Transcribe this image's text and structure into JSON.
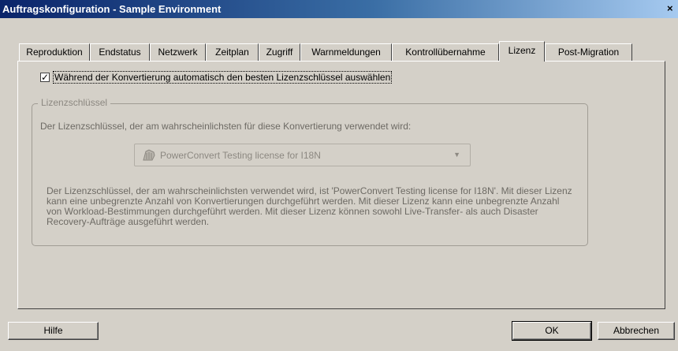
{
  "window": {
    "title": "Auftragskonfiguration - Sample Environment",
    "close_glyph": "×"
  },
  "tabs": [
    {
      "label": "Reproduktion"
    },
    {
      "label": "Endstatus"
    },
    {
      "label": "Netzwerk"
    },
    {
      "label": "Zeitplan"
    },
    {
      "label": "Zugriff"
    },
    {
      "label": "Warnmeldungen"
    },
    {
      "label": "Kontrollübernahme"
    },
    {
      "label": "Lizenz",
      "active": true
    },
    {
      "label": "Post-Migration"
    }
  ],
  "license_tab": {
    "auto_select": {
      "checked": true,
      "check_glyph": "✓",
      "label": "Während der Konvertierung automatisch den besten Lizenzschlüssel auswählen"
    },
    "group_title": "Lizenzschlüssel",
    "likely_key_label": "Der Lizenzschlüssel, der am wahrscheinlichsten für diese Konvertierung verwendet wird:",
    "select": {
      "value": "PowerConvert Testing license for I18N",
      "icon": "license-key-icon",
      "arrow_glyph": "▼"
    },
    "info": "Der Lizenzschlüssel, der am wahrscheinlichsten verwendet wird, ist 'PowerConvert Testing license for I18N'. Mit dieser Lizenz kann eine unbegrenzte Anzahl von Konvertierungen durchgeführt werden. Mit dieser Lizenz kann eine unbegrenzte Anzahl von Workload-Bestimmungen durchgeführt werden. Mit dieser Lizenz können sowohl Live-Transfer- als auch Disaster Recovery-Aufträge ausgeführt werden."
  },
  "buttons": {
    "help": "Hilfe",
    "ok": "OK",
    "cancel": "Abbrechen"
  },
  "colors": {
    "face": "#d4d0c8",
    "title_start": "#0a246a",
    "title_end": "#a6caf0",
    "disabled_text": "#8c8881"
  }
}
